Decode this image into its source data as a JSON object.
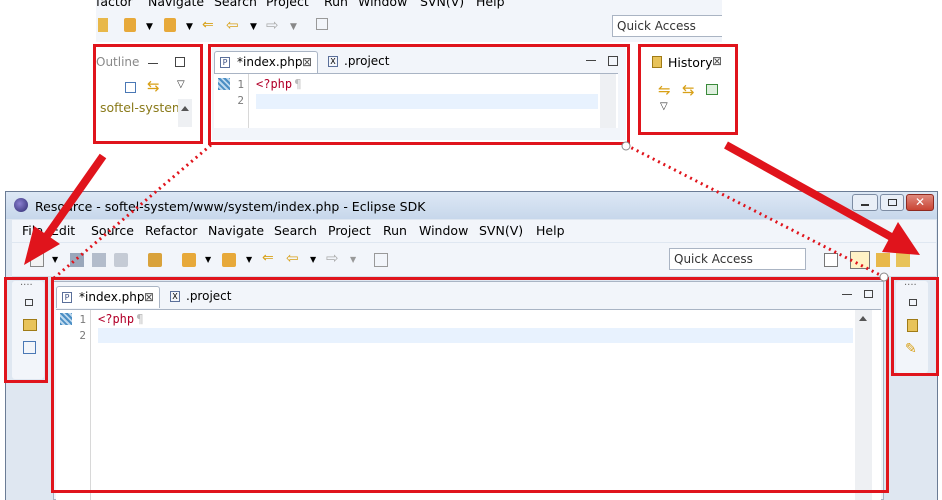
{
  "top": {
    "menu": [
      "factor",
      "Navigate",
      "Search",
      "Project",
      "Run",
      "Window",
      "SVN(V)",
      "Help"
    ],
    "quick_access": "Quick Access",
    "outline": {
      "title": "Outline",
      "tree_item": "softel-system"
    },
    "editor": {
      "tabs": [
        "*index.php",
        ".project"
      ],
      "lines": [
        "1",
        "2"
      ],
      "code": "<?php",
      "pilcrow": "¶"
    },
    "history": {
      "title": "History"
    }
  },
  "window": {
    "title": "Resource - softel-system/www/system/index.php - Eclipse SDK",
    "menu": [
      "File",
      "Edit",
      "Source",
      "Refactor",
      "Navigate",
      "Search",
      "Project",
      "Run",
      "Window",
      "SVN(V)",
      "Help"
    ],
    "quick_access": "Quick Access",
    "editor": {
      "tabs": [
        "*index.php",
        ".project"
      ],
      "lines": [
        "1",
        "2"
      ],
      "code": "<?php",
      "pilcrow": "¶"
    },
    "left_trim_dots": "....",
    "right_trim_dots": "...."
  },
  "colors": {
    "highlight_red": "#e0141c",
    "window_bg": "#dfe7f1",
    "current_line": "#e8f2fe",
    "php_tag": "#b2002a"
  }
}
